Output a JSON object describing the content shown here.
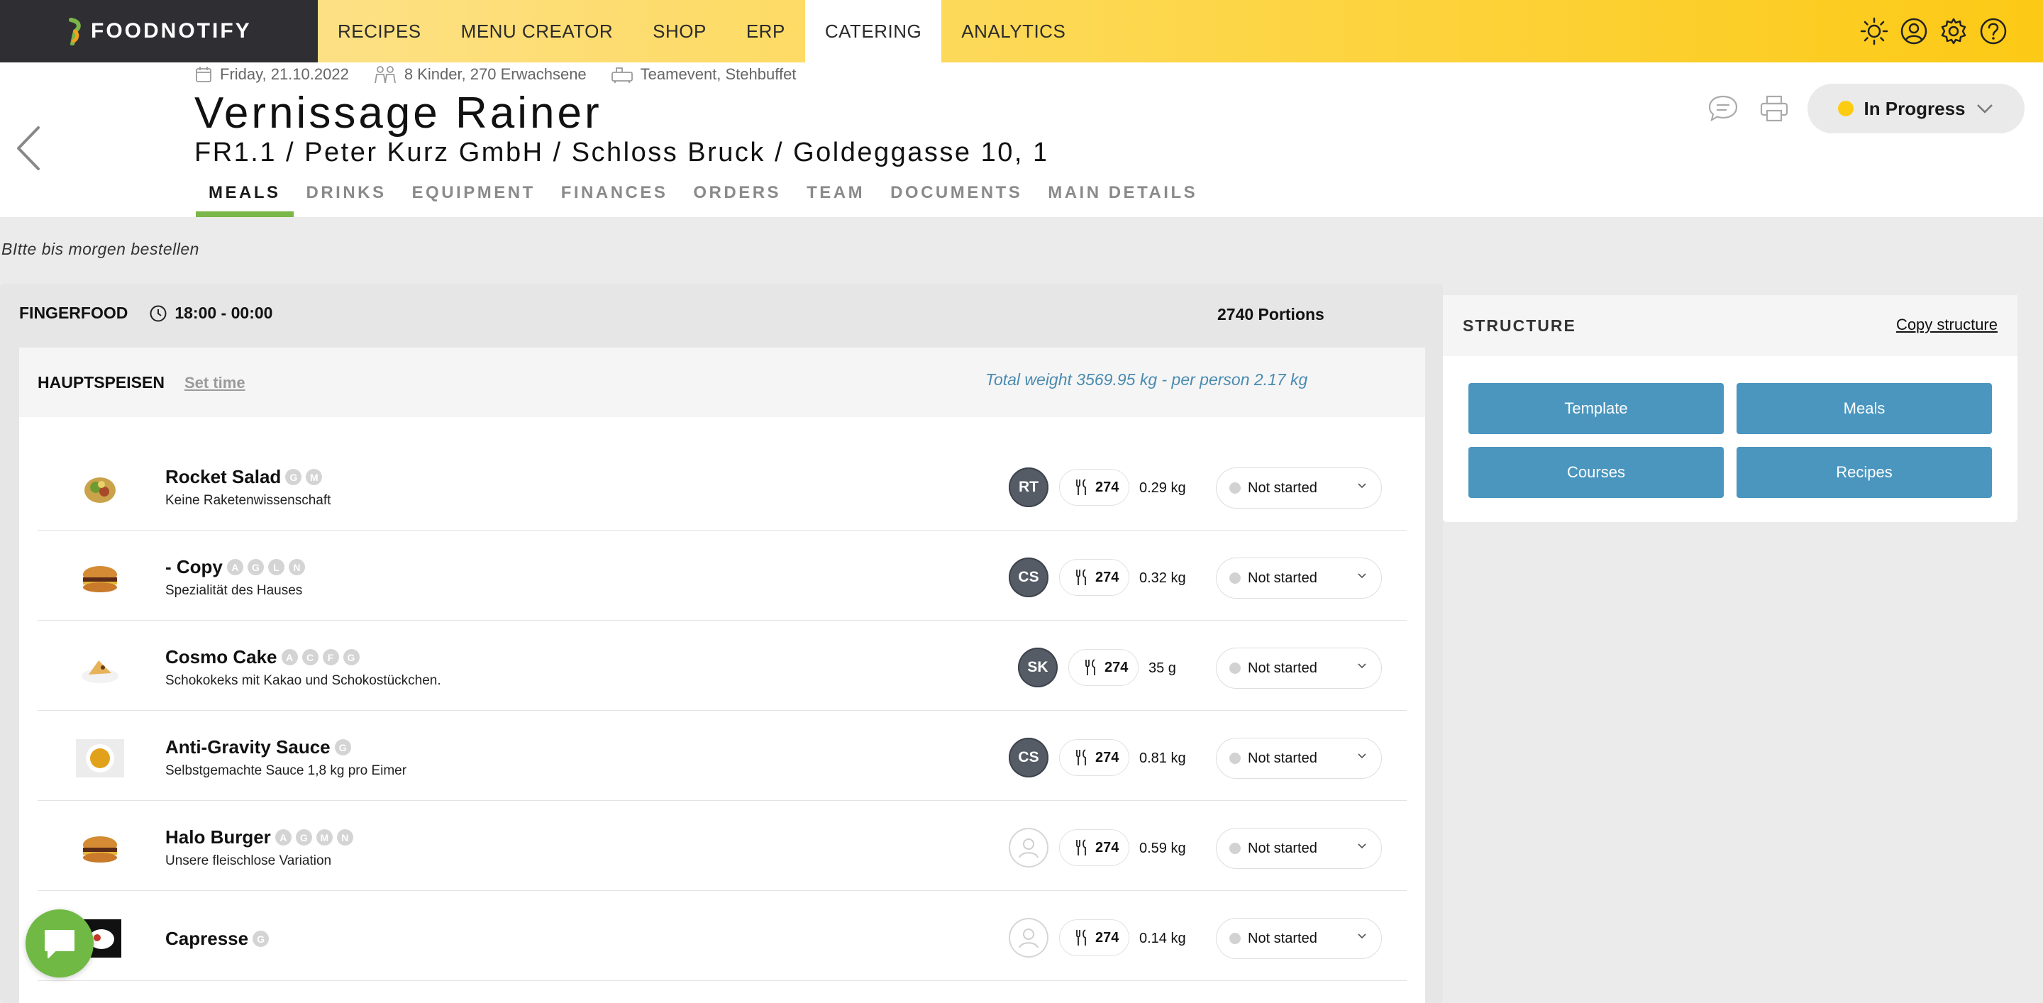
{
  "app": {
    "brand": "FOODNOTIFY"
  },
  "nav": {
    "items": [
      {
        "label": "RECIPES",
        "active": false
      },
      {
        "label": "MENU CREATOR",
        "active": false
      },
      {
        "label": "SHOP",
        "active": false
      },
      {
        "label": "ERP",
        "active": false
      },
      {
        "label": "CATERING",
        "active": true
      },
      {
        "label": "ANALYTICS",
        "active": false
      }
    ]
  },
  "top_icons": [
    "sun-icon",
    "user-icon",
    "gear-icon",
    "help-icon"
  ],
  "event": {
    "date": "Friday, 21.10.2022",
    "guests": "8 Kinder, 270 Erwachsene",
    "type": "Teamevent, Stehbuffet",
    "title": "Vernissage Rainer",
    "subtitle": "FR1.1 / Peter Kurz GmbH / Schloss Bruck / Goldeggasse 10, 1…",
    "status": "In Progress",
    "status_color": "#fccc12"
  },
  "tabs": [
    {
      "label": "MEALS",
      "active": true
    },
    {
      "label": "DRINKS",
      "active": false
    },
    {
      "label": "EQUIPMENT",
      "active": false
    },
    {
      "label": "FINANCES",
      "active": false
    },
    {
      "label": "ORDERS",
      "active": false
    },
    {
      "label": "TEAM",
      "active": false
    },
    {
      "label": "DOCUMENTS",
      "active": false
    },
    {
      "label": "MAIN DETAILS",
      "active": false
    }
  ],
  "note": "BItte bis morgen bestellen",
  "section": {
    "name": "FINGERFOOD",
    "time": "18:00 - 00:00",
    "portions": "2740 Portions"
  },
  "course": {
    "name": "HAUPTSPEISEN",
    "set_time": "Set time",
    "total_weight": "Total weight 3569.95 kg - per person 2.17 kg"
  },
  "meals": [
    {
      "name": "Rocket Salad",
      "allergens": [
        "G",
        "M"
      ],
      "desc": "Keine Raketenwissenschaft",
      "avatar": "RT",
      "qty": "274",
      "weight": "0.29 kg",
      "state": "Not started",
      "icon": "salad-image"
    },
    {
      "name": "- Copy",
      "allergens": [
        "A",
        "G",
        "L",
        "N"
      ],
      "desc": "Spezialität des Hauses",
      "avatar": "CS",
      "qty": "274",
      "weight": "0.32 kg",
      "state": "Not started",
      "icon": "burger-image"
    },
    {
      "name": "Cosmo Cake",
      "allergens": [
        "A",
        "C",
        "F",
        "G"
      ],
      "desc": "Schokokeks mit Kakao und Schokostückchen.",
      "avatar": "SK",
      "qty": "274",
      "weight": "35 g",
      "state": "Not started",
      "icon": "cake-image"
    },
    {
      "name": "Anti-Gravity Sauce",
      "allergens": [
        "G"
      ],
      "desc": "Selbstgemachte Sauce 1,8 kg pro Eimer",
      "avatar": "CS",
      "qty": "274",
      "weight": "0.81 kg",
      "state": "Not started",
      "icon": "sauce-image"
    },
    {
      "name": "Halo Burger",
      "allergens": [
        "A",
        "G",
        "M",
        "N"
      ],
      "desc": "Unsere fleischlose Variation",
      "avatar": "",
      "qty": "274",
      "weight": "0.59 kg",
      "state": "Not started",
      "icon": "burger-image"
    },
    {
      "name": "Capresse",
      "allergens": [
        "G"
      ],
      "desc": "",
      "avatar": "",
      "qty": "274",
      "weight": "0.14 kg",
      "state": "Not started",
      "icon": "caprese-image"
    }
  ],
  "structure": {
    "title": "STRUCTURE",
    "copy": "Copy structure",
    "buttons": [
      "Template",
      "Meals",
      "Courses",
      "Recipes"
    ]
  }
}
